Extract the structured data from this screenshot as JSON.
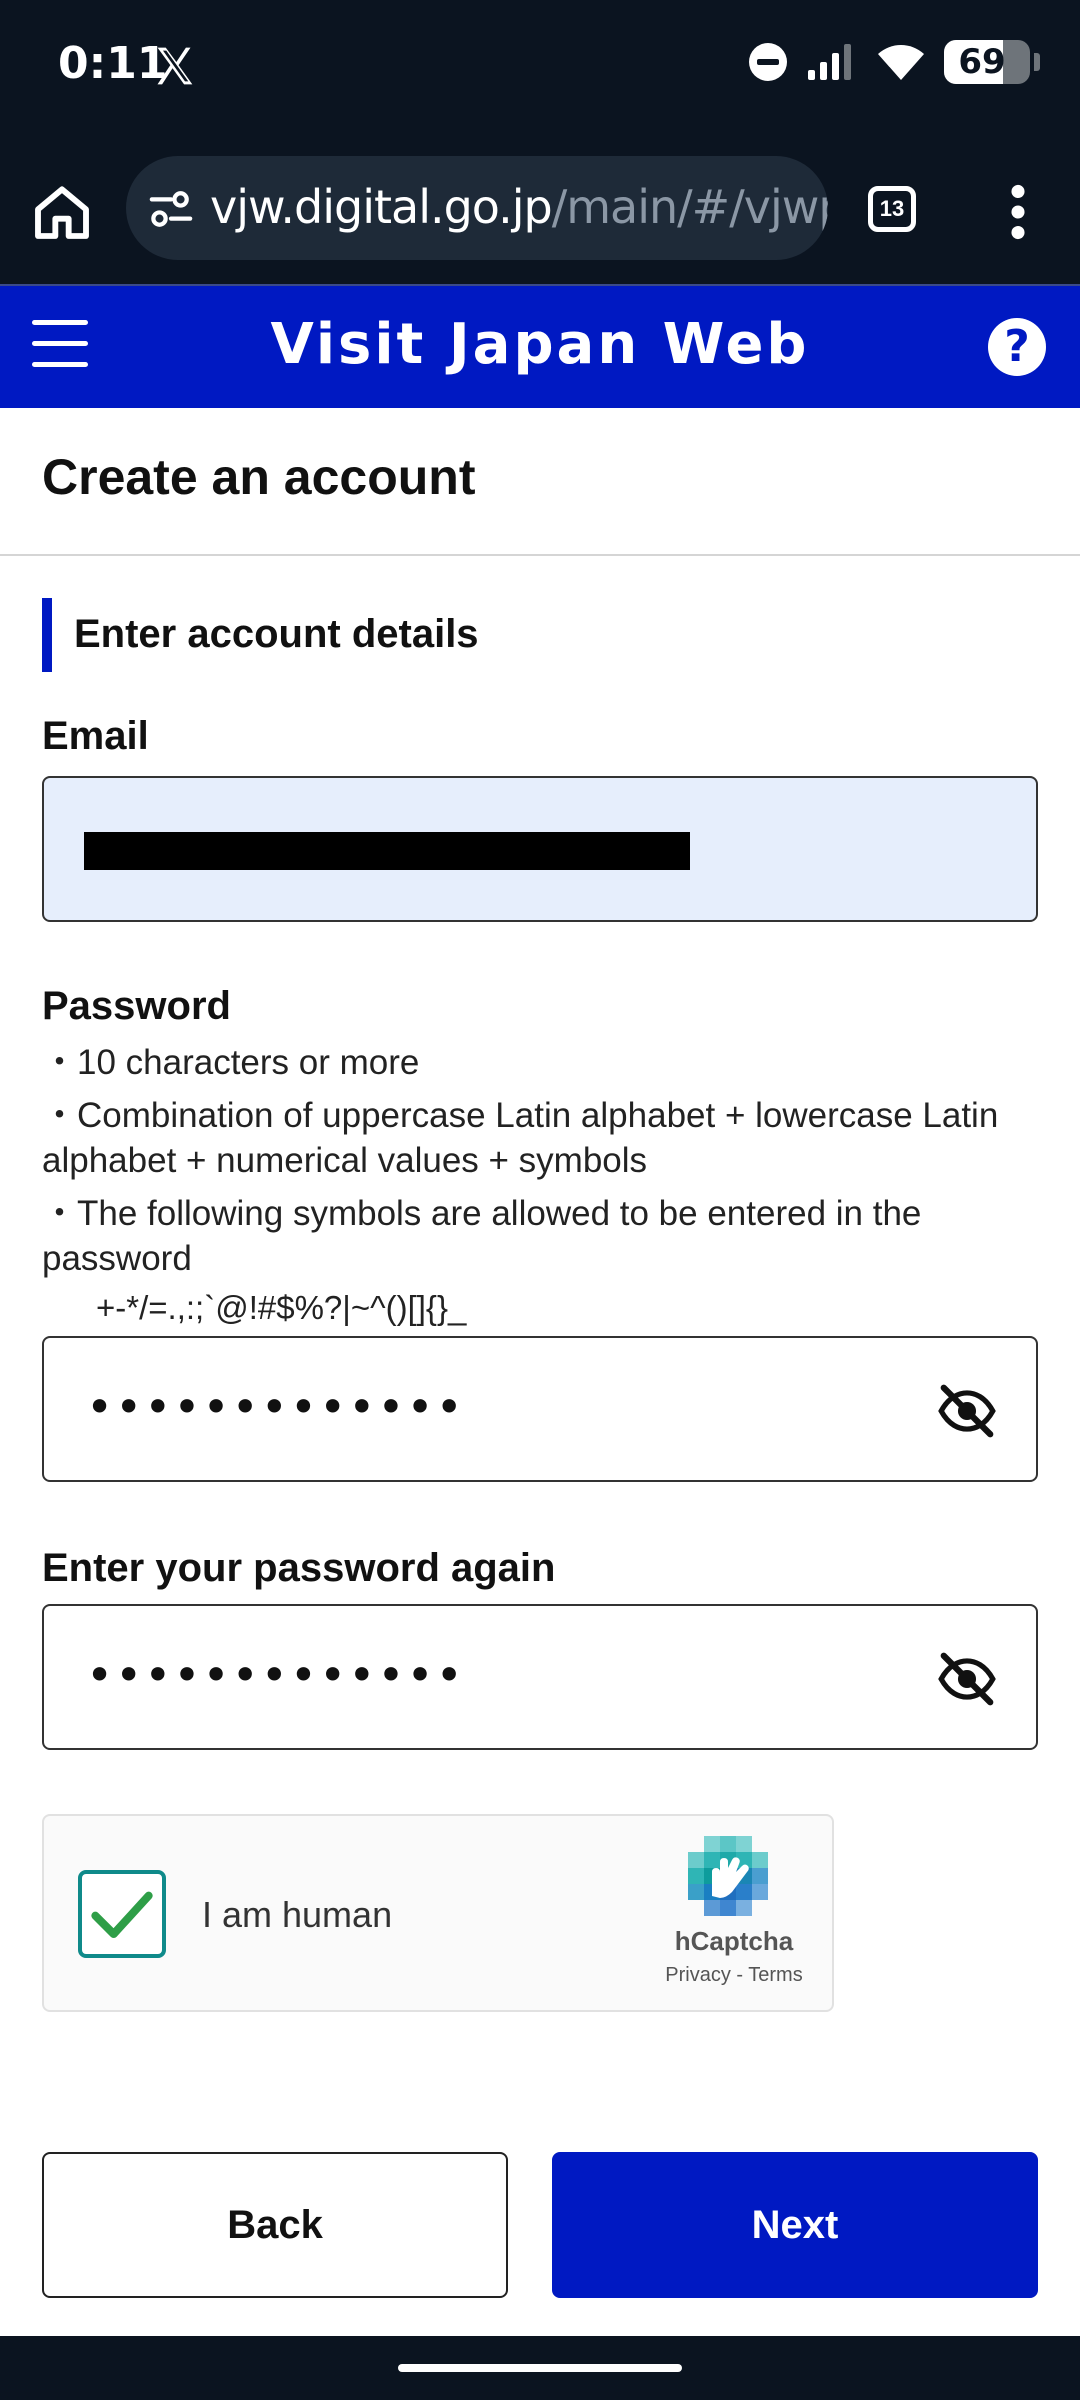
{
  "status_bar": {
    "time": "0:11",
    "battery_percent": 69,
    "battery_label": "69"
  },
  "browser": {
    "url_domain": "vjw.digital.go.jp",
    "url_path": "/main/#/vjwp",
    "tab_count": "13"
  },
  "app": {
    "title": "Visit Japan Web",
    "help_label": "?"
  },
  "page": {
    "title": "Create an account",
    "section_heading": "Enter account details"
  },
  "form": {
    "email_label": "Email",
    "password_label": "Password",
    "password_rules": [
      "・10 characters or more",
      "・Combination of uppercase Latin alphabet + lowercase Latin alphabet + numerical values + symbols",
      "・The following symbols are allowed to be entered in the password"
    ],
    "allowed_symbols": "+-*/=.,:;`@!#$%?|~^()[]{}_",
    "password_value": "•••••••••••••",
    "confirm_label": "Enter your password again",
    "confirm_value": "•••••••••••••"
  },
  "captcha": {
    "label": "I am human",
    "brand": "hCaptcha",
    "links": "Privacy - Terms",
    "checked": true
  },
  "buttons": {
    "back": "Back",
    "next": "Next"
  },
  "colors": {
    "brand_blue": "#0019c2",
    "system_bar": "#0b1420",
    "email_fill": "#e6eefc",
    "captcha_teal": "#0f8a8a"
  }
}
